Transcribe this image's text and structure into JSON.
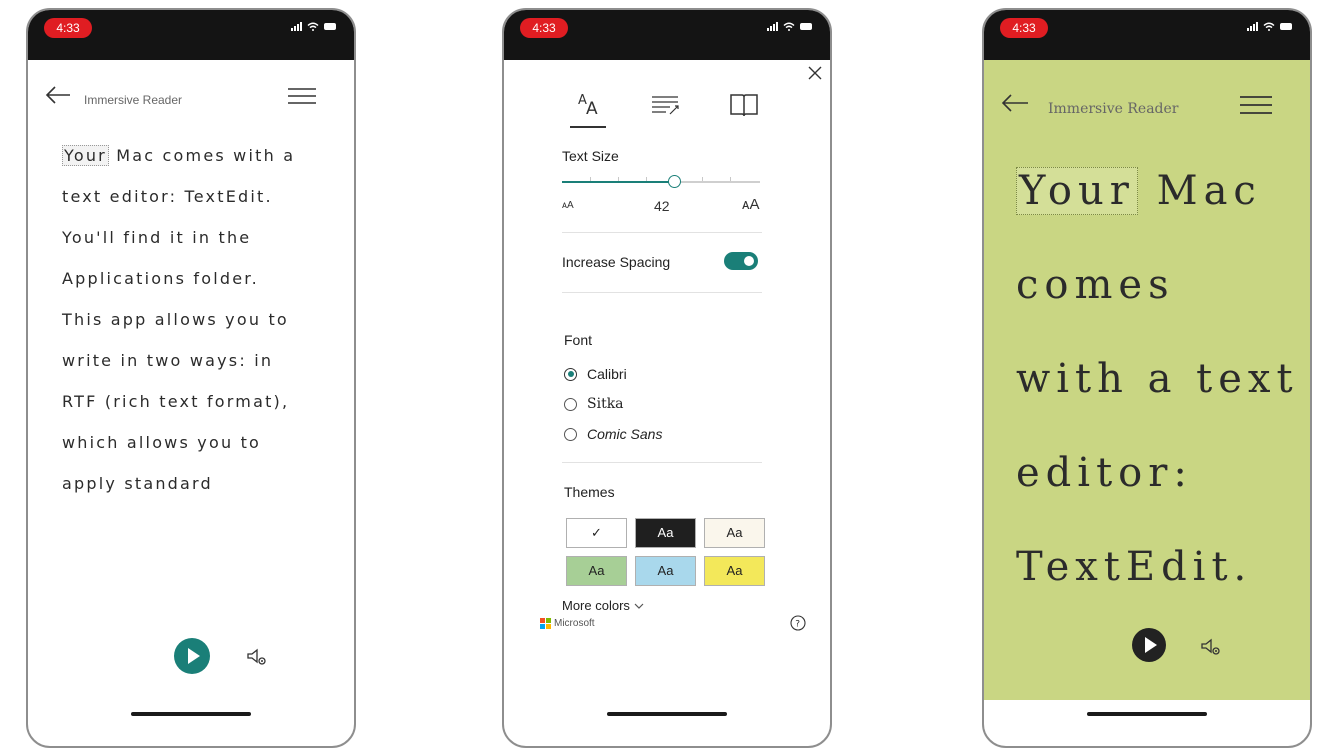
{
  "status": {
    "time": "4:33"
  },
  "reader": {
    "header_title": "Immersive Reader",
    "phone1_lines": [
      {
        "highlight": "Your",
        "rest": " Mac comes with a"
      },
      {
        "highlight": "",
        "rest": "text editor: TextEdit."
      },
      {
        "highlight": "",
        "rest": "You'll find it in the"
      },
      {
        "highlight": "",
        "rest": "Applications folder."
      },
      {
        "highlight": "",
        "rest": "This app allows you to"
      },
      {
        "highlight": "",
        "rest": "write in two ways: in"
      },
      {
        "highlight": "",
        "rest": "RTF (rich text format),"
      },
      {
        "highlight": "",
        "rest": "which allows you to"
      },
      {
        "highlight": "",
        "rest": "apply standard"
      }
    ],
    "phone3_lines": [
      {
        "highlight": "Your",
        "rest": " Mac"
      },
      {
        "highlight": "",
        "rest": "comes"
      },
      {
        "highlight": "",
        "rest": "with a text"
      },
      {
        "highlight": "",
        "rest": "editor:"
      },
      {
        "highlight": "",
        "rest": "TextEdit."
      }
    ],
    "phone3_background": "#c9d683",
    "accent_color": "#1a7f78"
  },
  "settings": {
    "tabs": [
      "text-size-icon",
      "grammar-options-icon",
      "reading-preferences-icon"
    ],
    "text_size": {
      "label": "Text Size",
      "value": "42",
      "value_fraction": 0.57,
      "small_label": "AA",
      "large_label": "AA"
    },
    "increase_spacing": {
      "label": "Increase Spacing",
      "on": true
    },
    "font": {
      "label": "Font",
      "options": [
        {
          "name": "Calibri",
          "selected": true
        },
        {
          "name": "Sitka",
          "selected": false
        },
        {
          "name": "Comic Sans",
          "selected": false
        }
      ]
    },
    "themes": {
      "label": "Themes",
      "items": [
        {
          "label": "✓",
          "bg": "#ffffff",
          "fg": "#222222",
          "selected": true
        },
        {
          "label": "Aa",
          "bg": "#1f1f1f",
          "fg": "#ffffff",
          "selected": false
        },
        {
          "label": "Aa",
          "bg": "#faf6ec",
          "fg": "#222222",
          "selected": false
        },
        {
          "label": "Aa",
          "bg": "#a7cf96",
          "fg": "#222222",
          "selected": false
        },
        {
          "label": "Aa",
          "bg": "#a9d8ec",
          "fg": "#222222",
          "selected": false
        },
        {
          "label": "Aa",
          "bg": "#f3e85a",
          "fg": "#222222",
          "selected": false
        }
      ]
    },
    "more_colors": "More colors",
    "brand": "Microsoft"
  }
}
